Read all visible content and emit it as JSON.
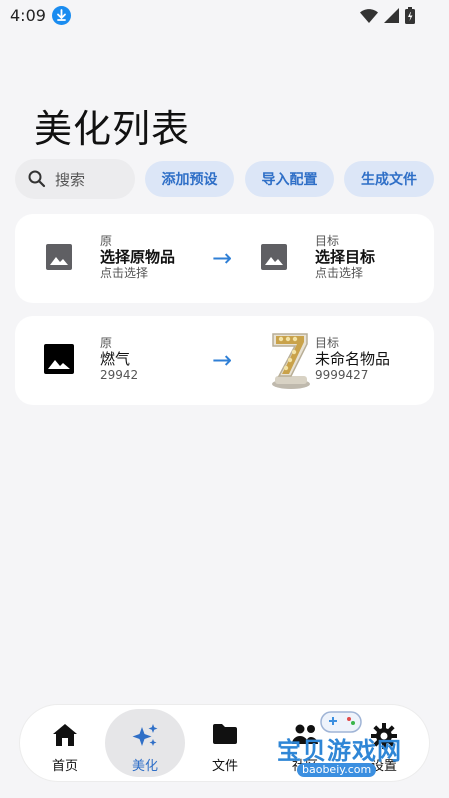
{
  "status_bar": {
    "time": "4:09"
  },
  "page_title": "美化列表",
  "toolbar": {
    "search_placeholder": "搜索",
    "btn_add_preset": "添加预设",
    "btn_import_config": "导入配置",
    "btn_generate_file": "生成文件"
  },
  "items": [
    {
      "src_small": "原",
      "src_title": "选择原物品",
      "src_sub": "点击选择",
      "dst_small": "目标",
      "dst_title": "选择目标",
      "dst_sub": "点击选择"
    },
    {
      "src_small": "原",
      "src_title": "燃气",
      "src_sub": "29942",
      "dst_small": "目标",
      "dst_title": "未命名物品",
      "dst_sub": "9999427"
    }
  ],
  "arrow_glyph": "→",
  "nav": {
    "home": "首页",
    "beautify": "美化",
    "files": "文件",
    "community": "社区",
    "settings": "设置"
  },
  "watermark": {
    "text": "宝贝游戏网",
    "url": "baobeiy.com"
  },
  "colors": {
    "accent": "#2f6fc7",
    "chip_bg": "#dce6f7",
    "page_bg": "#f5f5f7"
  }
}
